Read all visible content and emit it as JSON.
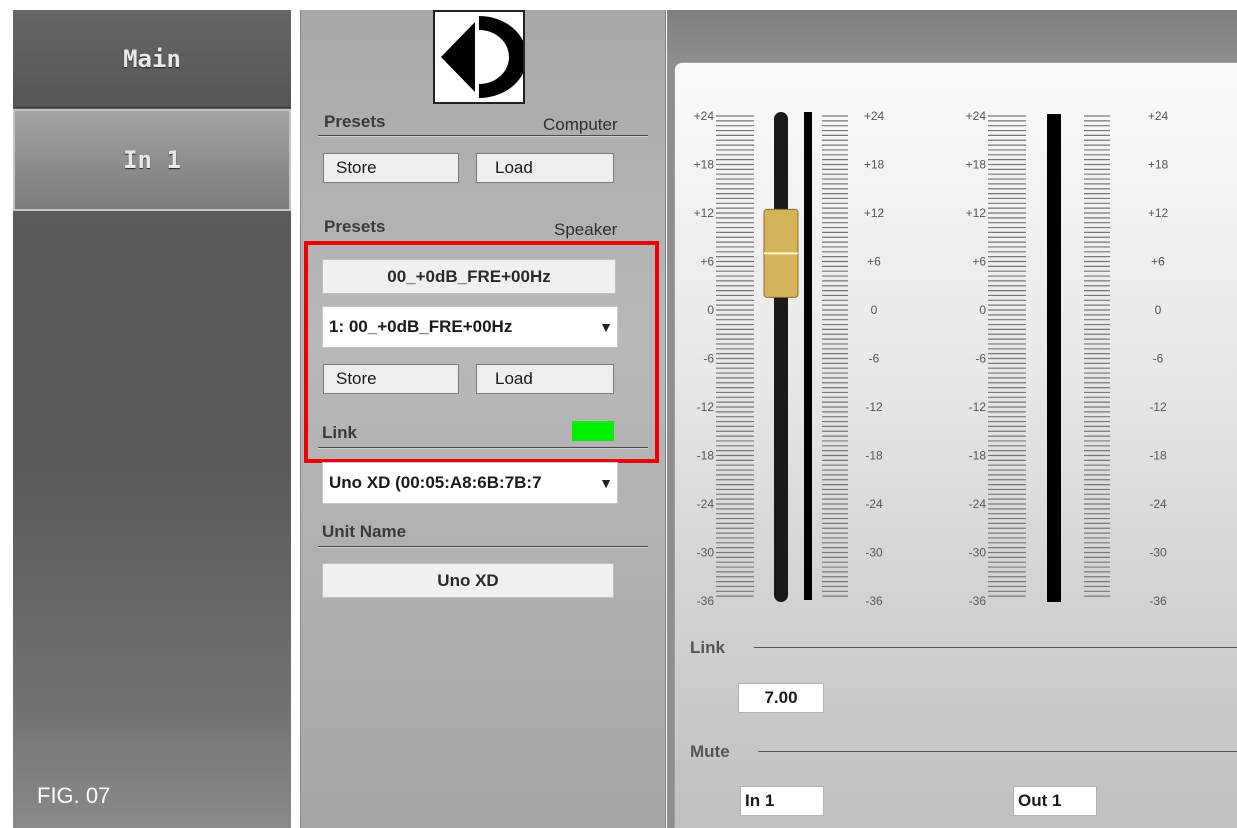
{
  "sidebar": {
    "tabs": [
      {
        "label": "Main"
      },
      {
        "label": "In 1"
      }
    ],
    "figure_label": "FIG. 07"
  },
  "presets_computer": {
    "title": "Presets",
    "source": "Computer",
    "store_label": "Store",
    "load_label": "Load"
  },
  "presets_speaker": {
    "title": "Presets",
    "source": "Speaker",
    "current_name": "00_+0dB_FRE+00Hz",
    "selected_option": "1: 00_+0dB_FRE+00Hz",
    "store_label": "Store",
    "load_label": "Load"
  },
  "link": {
    "label": "Link",
    "status_color": "#00ee00",
    "device_selected": "Uno XD (00:05:A8:6B:7B:7"
  },
  "unit": {
    "label": "Unit Name",
    "name": "Uno XD"
  },
  "meters": {
    "scale_labels": [
      "+24",
      "+18",
      "+12",
      "+6",
      "0",
      "-6",
      "-12",
      "-18",
      "-24",
      "-30",
      "-36"
    ],
    "fader_level_db": 7.0
  },
  "right": {
    "link_label": "Link",
    "link_value": "7.00",
    "mute_label": "Mute",
    "mute_in": "In 1",
    "mute_out": "Out 1"
  },
  "colors": {
    "highlight": "#ee0000",
    "fader_cap": "#d4b35a"
  }
}
